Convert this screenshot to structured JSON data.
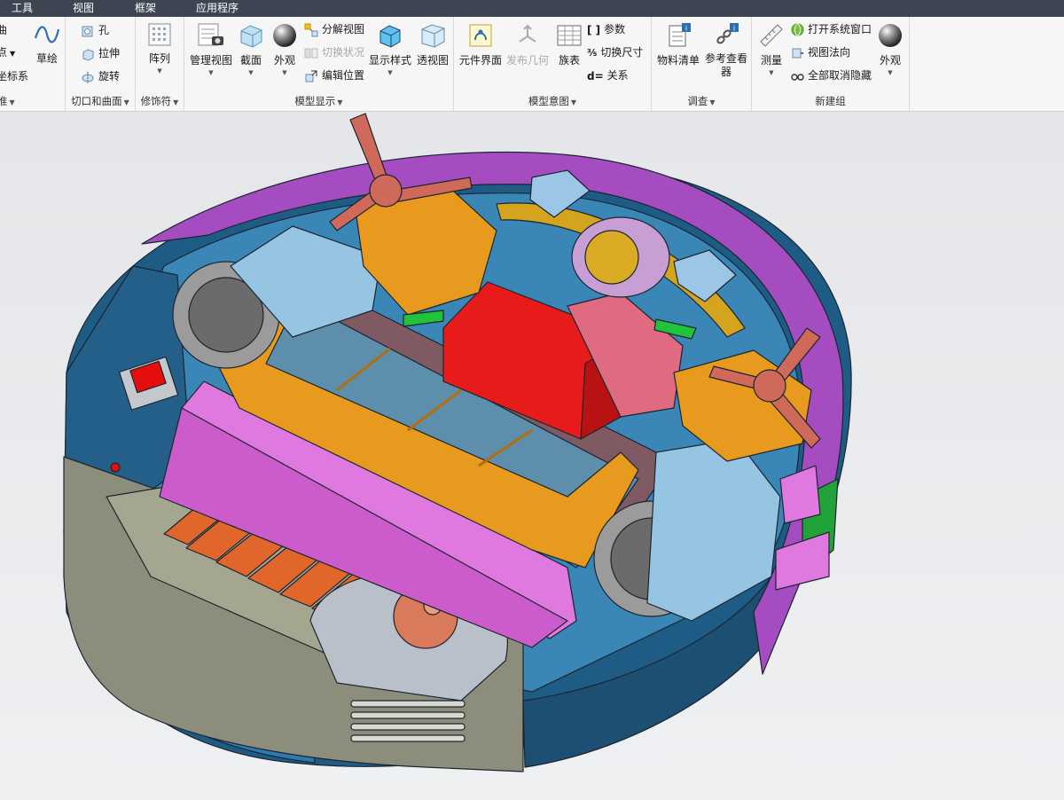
{
  "menu": {
    "tools": "工具",
    "view": "视图",
    "frame": "框架",
    "apps": "应用程序"
  },
  "datum_group": {
    "curve_suffix": "曲",
    "point_suffix": "点",
    "csys_suffix": "坐标系",
    "sketch": "草绘",
    "group_suffix": "准"
  },
  "cut_surface_group": {
    "hole": "孔",
    "extrude": "拉伸",
    "revolve": "旋转",
    "label": "切口和曲面"
  },
  "modifier_group": {
    "pattern": "阵列",
    "label": "修饰符"
  },
  "model_display_group": {
    "manage_views": "管理视图",
    "section": "截面",
    "appearance": "外观",
    "exploded_view": "分解视图",
    "toggle_status": "切换状况",
    "edit_position": "编辑位置",
    "display_style": "显示样式",
    "perspective": "透视图",
    "label": "模型显示"
  },
  "model_intent_group": {
    "component_interface": "元件界面",
    "publish_geometry": "发布几何",
    "family_table": "族表",
    "parameters": "参数",
    "switch_dimensions": "切换尺寸",
    "relations": "关系",
    "label": "模型意图"
  },
  "investigate_group": {
    "bill_of_materials": "物料清单",
    "reference_viewer": "参考查看器",
    "label": "调查"
  },
  "new_group": {
    "measure": "测量",
    "open_system_window": "打开系统窗口",
    "view_normal": "视图法向",
    "unhide_all": "全部取消隐藏",
    "appearance": "外观",
    "label": "新建组"
  }
}
